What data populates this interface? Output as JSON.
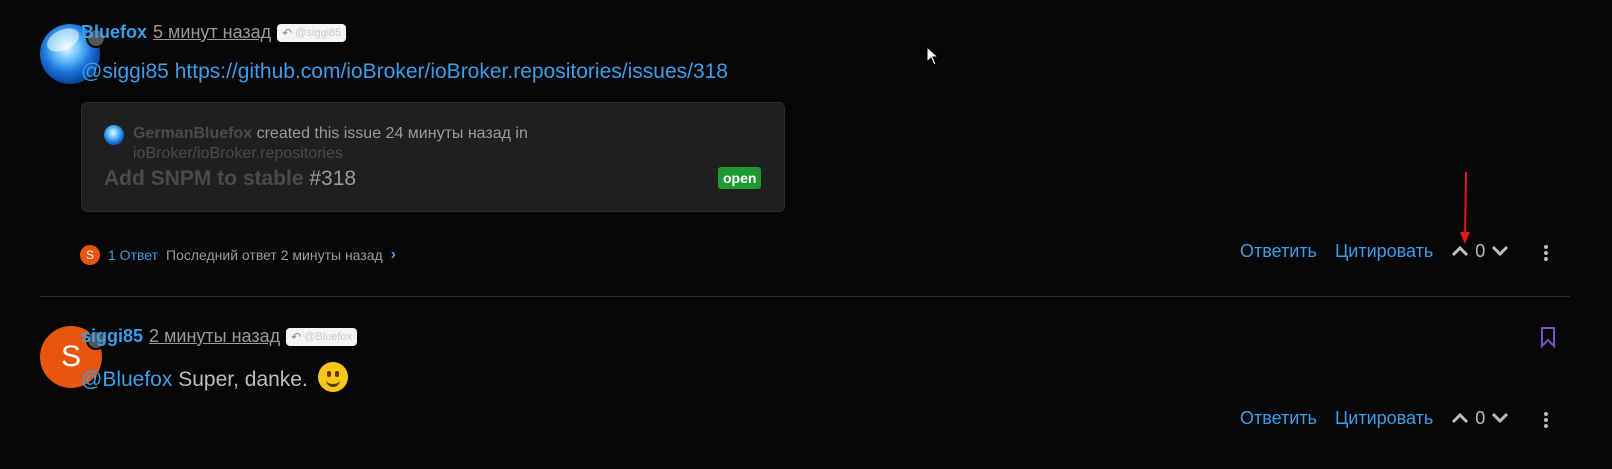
{
  "posts": [
    {
      "author": "Bluefox",
      "time": "5 минут назад",
      "reply_to": "@siggi85",
      "content": {
        "mention": "@siggi85",
        "link": "https://github.com/ioBroker/ioBroker.repositories/issues/318"
      },
      "embed": {
        "user": "GermanBluefox",
        "action": "created this issue 24 минуты назад in",
        "repo": "ioBroker/ioBroker.repositories",
        "title": "Add SNPM to stable",
        "number": "#318",
        "status": "open"
      },
      "replies": {
        "avatar_letter": "S",
        "count": "1 Ответ",
        "last": "Последний ответ 2 минуты назад"
      },
      "actions": {
        "reply": "Ответить",
        "quote": "Цитировать",
        "votes": "0"
      }
    },
    {
      "author": "siggi85",
      "avatar_letter": "S",
      "time": "2 минуты назад",
      "reply_to": "@Bluefox",
      "content": {
        "mention": "@Bluefox",
        "text": "Super, danke."
      },
      "actions": {
        "reply": "Ответить",
        "quote": "Цитировать",
        "votes": "0"
      }
    }
  ],
  "colors": {
    "link": "#3a9ee8",
    "open_badge": "#1e9a2e",
    "avatar_s": "#e8550f",
    "bookmark": "#7b4fbf",
    "annotation": "#e0161b"
  },
  "icons": [
    "reply-arrow-icon",
    "chevron-up-icon",
    "chevron-down-icon",
    "chevron-right-icon",
    "more-vertical-icon",
    "bookmark-icon",
    "smiley-emoji-icon",
    "cursor-icon",
    "annotation-arrow-icon"
  ]
}
